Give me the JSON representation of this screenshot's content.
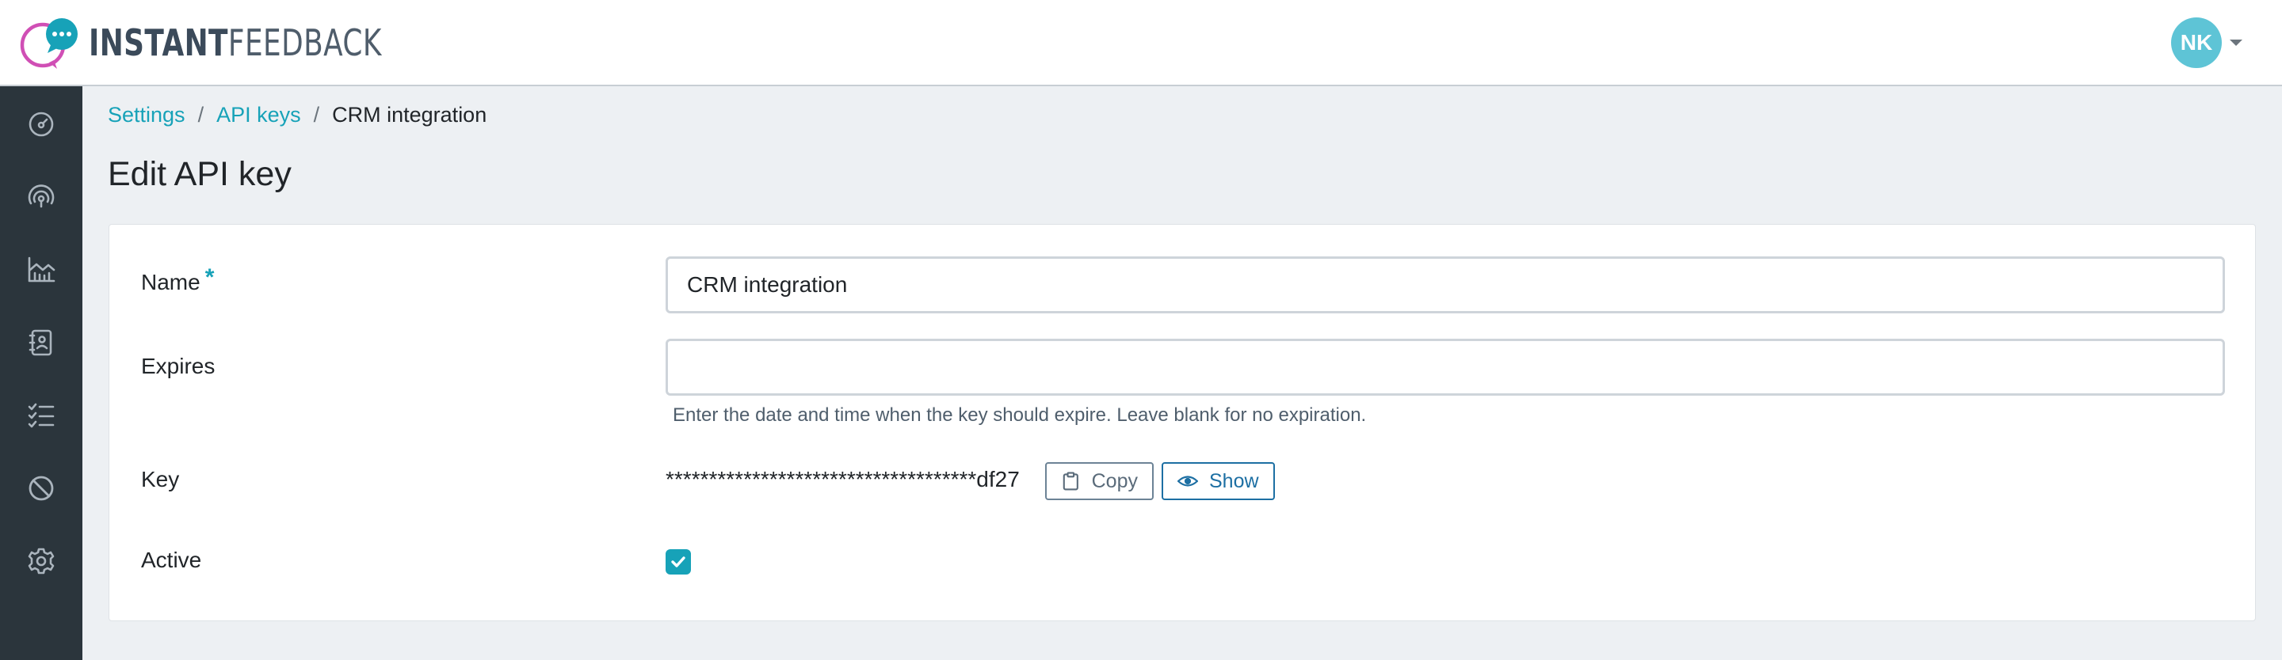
{
  "app": {
    "logo_text_bold": "INSTANT",
    "logo_text_light": "FEEDBACK",
    "brand_color": "#17a2b8",
    "logo_ring_color": "#d04fb5"
  },
  "user": {
    "initials": "NK",
    "avatar_color": "#5ec4d6"
  },
  "sidebar": {
    "items": [
      {
        "icon": "dashboard-gauge-icon"
      },
      {
        "icon": "broadcast-icon"
      },
      {
        "icon": "chart-icon"
      },
      {
        "icon": "contact-book-icon"
      },
      {
        "icon": "checklist-icon"
      },
      {
        "icon": "block-icon"
      },
      {
        "icon": "gear-icon"
      }
    ]
  },
  "breadcrumb": {
    "items": [
      "Settings",
      "API keys"
    ],
    "separator": "/",
    "current": "CRM integration"
  },
  "page": {
    "title": "Edit API key"
  },
  "form": {
    "name": {
      "label": "Name",
      "required_mark": "*",
      "value": "CRM integration"
    },
    "expires": {
      "label": "Expires",
      "value": "",
      "help": "Enter the date and time when the key should expire. Leave blank for no expiration."
    },
    "key": {
      "label": "Key",
      "masked_value": "************************************df27",
      "copy_label": "Copy",
      "show_label": "Show"
    },
    "active": {
      "label": "Active",
      "checked": true
    }
  }
}
